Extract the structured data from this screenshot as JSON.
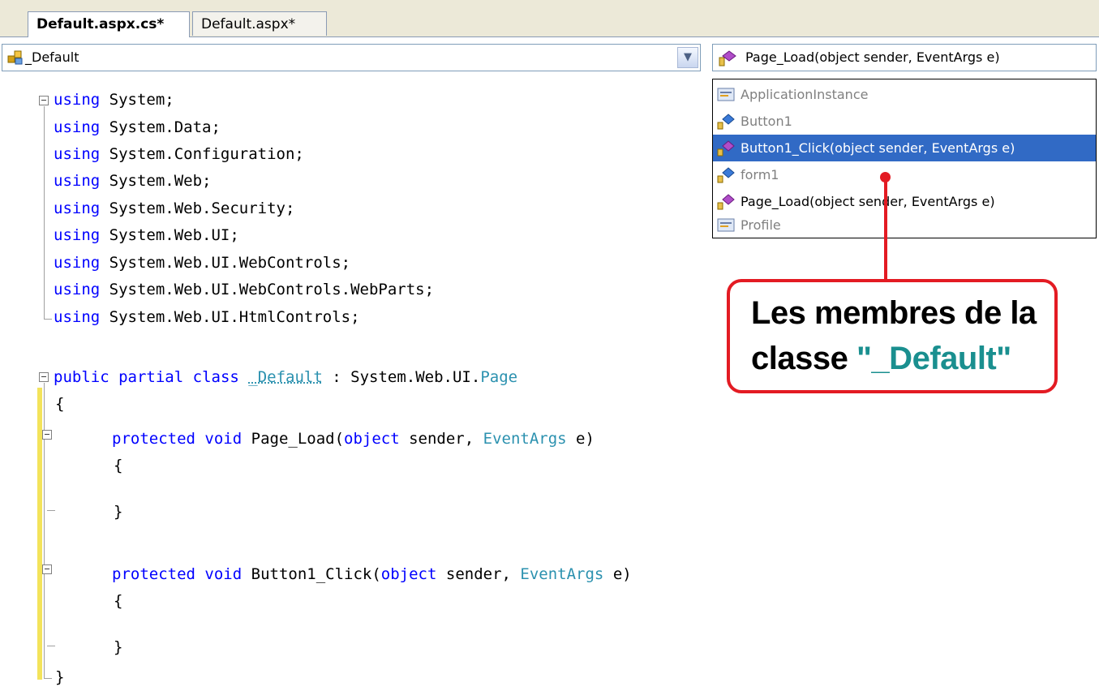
{
  "tabs": [
    {
      "label": "Default.aspx.cs*",
      "active": true
    },
    {
      "label": "Default.aspx*",
      "active": false
    }
  ],
  "class_combo": {
    "value": "_Default",
    "icon": "class-icon"
  },
  "member_combo": {
    "value": "Page_Load(object sender, EventArgs e)",
    "icon": "method-icon"
  },
  "member_list": [
    {
      "label": "ApplicationInstance",
      "icon": "property-icon",
      "state": "inherited"
    },
    {
      "label": "Button1",
      "icon": "field-icon",
      "state": "inherited"
    },
    {
      "label": "Button1_Click(object sender, EventArgs e)",
      "icon": "method-icon",
      "state": "selected"
    },
    {
      "label": "form1",
      "icon": "field-icon",
      "state": "inherited"
    },
    {
      "label": "Page_Load(object sender, EventArgs e)",
      "icon": "method-icon",
      "state": "normal"
    },
    {
      "label": "Profile",
      "icon": "property-icon",
      "state": "inherited"
    }
  ],
  "code": {
    "using_keyword": "using",
    "usings": [
      "System;",
      "System.Data;",
      "System.Configuration;",
      "System.Web;",
      "System.Web.Security;",
      "System.Web.UI;",
      "System.Web.UI.WebControls;",
      "System.Web.UI.WebControls.WebParts;",
      "System.Web.UI.HtmlControls;"
    ],
    "class_decl": {
      "kw1": "public",
      "kw2": "partial",
      "kw3": "class",
      "name": "_Default",
      "sep": ":",
      "base_ns": "System.Web.UI.",
      "base_type": "Page"
    },
    "open_brace": "{",
    "close_brace": "}",
    "methods": [
      {
        "kw1": "protected",
        "kw2": "void",
        "name": "Page_Load(",
        "p1_type": "object",
        "p1_name": "sender,",
        "p2_type": "EventArgs",
        "p2_name": "e)"
      },
      {
        "kw1": "protected",
        "kw2": "void",
        "name": "Button1_Click(",
        "p1_type": "object",
        "p1_name": "sender,",
        "p2_type": "EventArgs",
        "p2_name": "e)"
      }
    ]
  },
  "callout": {
    "line1": "Les membres de la",
    "line2_prefix": "classe",
    "line2_highlight": "\"_Default\""
  },
  "colors": {
    "keyword": "#0000ff",
    "type": "#2b91af",
    "selection": "#316ac5",
    "callout_border": "#e31b23",
    "callout_highlight": "#1a8f8f"
  }
}
